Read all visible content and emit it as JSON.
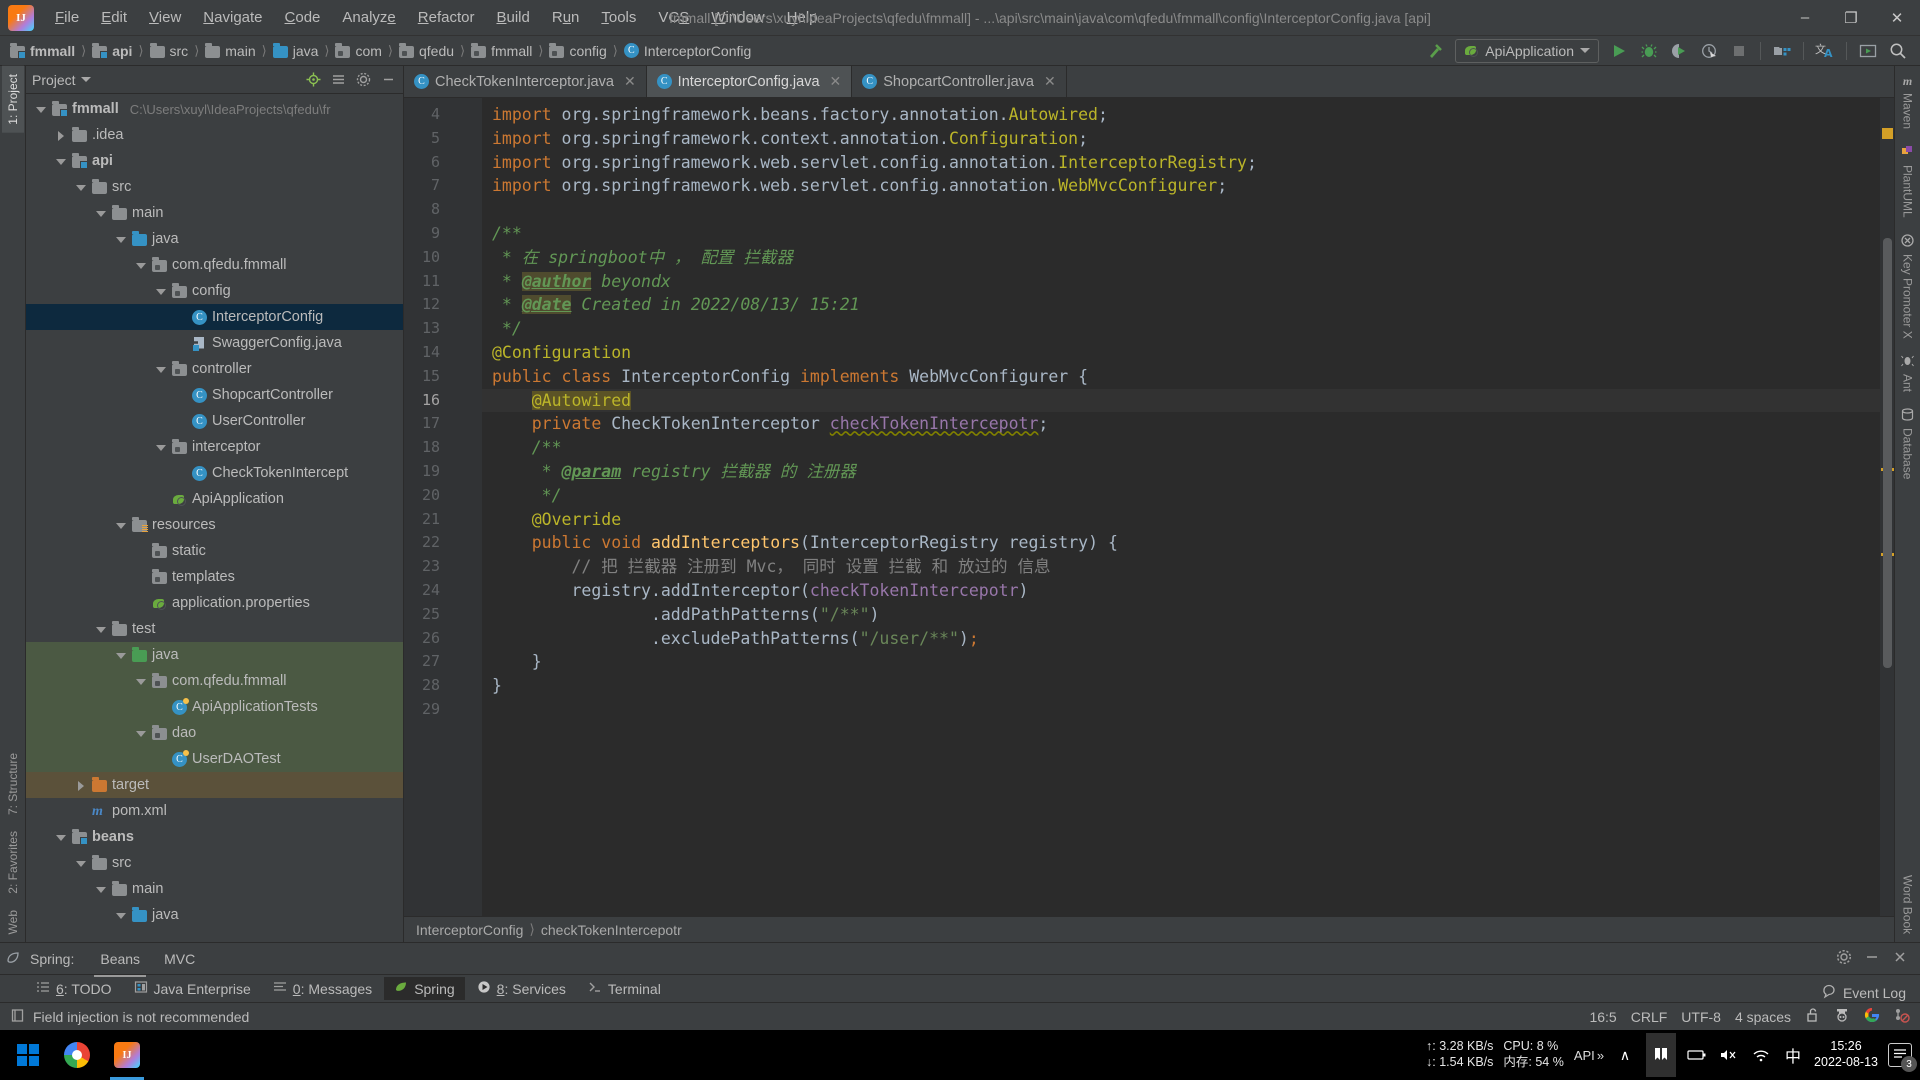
{
  "window": {
    "title": "fmmall [C:\\Users\\xuyl\\IdeaProjects\\qfedu\\fmmall] - ...\\api\\src\\main\\java\\com\\qfedu\\fmmall\\config\\InterceptorConfig.java [api]",
    "minimize": "–",
    "maximize": "❐",
    "close": "✕"
  },
  "menu": [
    {
      "label": "File"
    },
    {
      "label": "Edit"
    },
    {
      "label": "View"
    },
    {
      "label": "Navigate"
    },
    {
      "label": "Code"
    },
    {
      "label": "Analyze"
    },
    {
      "label": "Refactor"
    },
    {
      "label": "Build"
    },
    {
      "label": "Run"
    },
    {
      "label": "Tools"
    },
    {
      "label": "VCS"
    },
    {
      "label": "Window"
    },
    {
      "label": "Help"
    }
  ],
  "breadcrumbs": [
    {
      "label": "fmmall",
      "icon": "module-icon",
      "bold": true
    },
    {
      "label": "api",
      "icon": "module-icon",
      "bold": true
    },
    {
      "label": "src",
      "icon": "folder-icon"
    },
    {
      "label": "main",
      "icon": "folder-icon"
    },
    {
      "label": "java",
      "icon": "source-folder-icon"
    },
    {
      "label": "com",
      "icon": "package-icon"
    },
    {
      "label": "qfedu",
      "icon": "package-icon"
    },
    {
      "label": "fmmall",
      "icon": "package-icon"
    },
    {
      "label": "config",
      "icon": "package-icon"
    },
    {
      "label": "InterceptorConfig",
      "icon": "class-icon"
    }
  ],
  "toolbar": {
    "run_config": "ApiApplication",
    "buttons": [
      {
        "name": "build-hammer-icon",
        "glyph": "⚒"
      },
      {
        "name": "run-icon",
        "glyph": "▶"
      },
      {
        "name": "debug-icon",
        "glyph": "🐞"
      },
      {
        "name": "run-coverage-icon",
        "glyph": "◑"
      },
      {
        "name": "profiler-icon",
        "glyph": "⏱"
      },
      {
        "name": "stop-icon",
        "glyph": "■"
      },
      {
        "name": "project-structure-icon",
        "glyph": "▤"
      },
      {
        "name": "translate-icon",
        "glyph": "文A"
      },
      {
        "name": "presentation-icon",
        "glyph": "▭"
      },
      {
        "name": "search-everywhere-icon",
        "glyph": "🔍"
      }
    ]
  },
  "project_panel": {
    "title": "Project",
    "tree": [
      {
        "label": "fmmall",
        "path": "C:\\Users\\xuyl\\IdeaProjects\\qfedu\\fr",
        "indent": 0,
        "arrow": "open",
        "icon": "module-icon",
        "bold": true
      },
      {
        "label": ".idea",
        "indent": 1,
        "arrow": "closed",
        "icon": "folder-icon"
      },
      {
        "label": "api",
        "indent": 1,
        "arrow": "open",
        "icon": "module-icon",
        "bold": true
      },
      {
        "label": "src",
        "indent": 2,
        "arrow": "open",
        "icon": "folder-icon"
      },
      {
        "label": "main",
        "indent": 3,
        "arrow": "open",
        "icon": "folder-icon"
      },
      {
        "label": "java",
        "indent": 4,
        "arrow": "open",
        "icon": "source-folder-icon"
      },
      {
        "label": "com.qfedu.fmmall",
        "indent": 5,
        "arrow": "open",
        "icon": "package-icon"
      },
      {
        "label": "config",
        "indent": 6,
        "arrow": "open",
        "icon": "package-icon"
      },
      {
        "label": "InterceptorConfig",
        "indent": 7,
        "arrow": "none",
        "icon": "class-icon",
        "selected": true
      },
      {
        "label": "SwaggerConfig.java",
        "indent": 7,
        "arrow": "none",
        "icon": "swagger-icon"
      },
      {
        "label": "controller",
        "indent": 6,
        "arrow": "open",
        "icon": "package-icon"
      },
      {
        "label": "ShopcartController",
        "indent": 7,
        "arrow": "none",
        "icon": "class-icon"
      },
      {
        "label": "UserController",
        "indent": 7,
        "arrow": "none",
        "icon": "class-icon"
      },
      {
        "label": "interceptor",
        "indent": 6,
        "arrow": "open",
        "icon": "package-icon"
      },
      {
        "label": "CheckTokenIntercept",
        "indent": 7,
        "arrow": "none",
        "icon": "class-icon"
      },
      {
        "label": "ApiApplication",
        "indent": 6,
        "arrow": "none",
        "icon": "spring-icon"
      },
      {
        "label": "resources",
        "indent": 4,
        "arrow": "open",
        "icon": "resource-folder-icon"
      },
      {
        "label": "static",
        "indent": 5,
        "arrow": "none",
        "icon": "package-icon"
      },
      {
        "label": "templates",
        "indent": 5,
        "arrow": "none",
        "icon": "package-icon"
      },
      {
        "label": "application.properties",
        "indent": 5,
        "arrow": "none",
        "icon": "spring-icon"
      },
      {
        "label": "test",
        "indent": 3,
        "arrow": "open",
        "icon": "folder-icon"
      },
      {
        "label": "java",
        "indent": 4,
        "arrow": "open",
        "icon": "test-source-folder-icon",
        "bg": "green"
      },
      {
        "label": "com.qfedu.fmmall",
        "indent": 5,
        "arrow": "open",
        "icon": "package-icon",
        "bg": "green"
      },
      {
        "label": "ApiApplicationTests",
        "indent": 6,
        "arrow": "none",
        "icon": "test-class-icon",
        "bg": "green"
      },
      {
        "label": "dao",
        "indent": 5,
        "arrow": "open",
        "icon": "package-icon",
        "bg": "green"
      },
      {
        "label": "UserDAOTest",
        "indent": 6,
        "arrow": "none",
        "icon": "test-class-icon",
        "bg": "green"
      },
      {
        "label": "target",
        "indent": 2,
        "arrow": "closed",
        "icon": "excluded-folder-icon",
        "bg": "brown"
      },
      {
        "label": "pom.xml",
        "indent": 2,
        "arrow": "none",
        "icon": "maven-icon"
      },
      {
        "label": "beans",
        "indent": 1,
        "arrow": "open",
        "icon": "module-icon",
        "bold": true
      },
      {
        "label": "src",
        "indent": 2,
        "arrow": "open",
        "icon": "folder-icon"
      },
      {
        "label": "main",
        "indent": 3,
        "arrow": "open",
        "icon": "folder-icon"
      },
      {
        "label": "java",
        "indent": 4,
        "arrow": "open",
        "icon": "source-folder-icon"
      }
    ]
  },
  "left_strip": [
    {
      "label": "1: Project",
      "selected": true
    },
    {
      "label": "7: Structure",
      "selected": false
    },
    {
      "label": "2: Favorites",
      "selected": false
    },
    {
      "label": "Web",
      "selected": false
    }
  ],
  "right_strip": [
    {
      "label": "Maven",
      "icon": "maven-icon"
    },
    {
      "label": "PlantUML",
      "icon": "plantuml-icon"
    },
    {
      "label": "Key Promoter X",
      "icon": "key-promoter-icon"
    },
    {
      "label": "Ant",
      "icon": "ant-icon"
    },
    {
      "label": "Database",
      "icon": "database-icon"
    },
    {
      "label": "Word Book",
      "icon": "wordbook-icon"
    }
  ],
  "editor_tabs": [
    {
      "label": "CheckTokenInterceptor.java",
      "active": false
    },
    {
      "label": "InterceptorConfig.java",
      "active": true
    },
    {
      "label": "ShopcartController.java",
      "active": false
    }
  ],
  "editor": {
    "first_line": 4,
    "last_line": 29,
    "current_line": 16,
    "code_lines": [
      {
        "n": 4,
        "text": "import org.springframework.beans.factory.annotation.Autowired;"
      },
      {
        "n": 5,
        "text": "import org.springframework.context.annotation.Configuration;"
      },
      {
        "n": 6,
        "text": "import org.springframework.web.servlet.config.annotation.InterceptorRegistry;"
      },
      {
        "n": 7,
        "text": "import org.springframework.web.servlet.config.annotation.WebMvcConfigurer;"
      },
      {
        "n": 8,
        "text": ""
      },
      {
        "n": 9,
        "text": "/**"
      },
      {
        "n": 10,
        "text": " * 在 springboot中 ， 配置 拦截器"
      },
      {
        "n": 11,
        "text": " * @author beyondx"
      },
      {
        "n": 12,
        "text": " * @date Created in 2022/08/13/ 15:21"
      },
      {
        "n": 13,
        "text": " */"
      },
      {
        "n": 14,
        "text": "@Configuration"
      },
      {
        "n": 15,
        "text": "public class InterceptorConfig implements WebMvcConfigurer {"
      },
      {
        "n": 16,
        "text": "    @Autowired"
      },
      {
        "n": 17,
        "text": "    private CheckTokenInterceptor checkTokenIntercepotr;"
      },
      {
        "n": 18,
        "text": "    /**"
      },
      {
        "n": 19,
        "text": "     * @param registry 拦截器 的 注册器"
      },
      {
        "n": 20,
        "text": "     */"
      },
      {
        "n": 21,
        "text": "    @Override"
      },
      {
        "n": 22,
        "text": "    public void addInterceptors(InterceptorRegistry registry) {"
      },
      {
        "n": 23,
        "text": "        // 把 拦截器 注册到 Mvc， 同时 设置 拦截 和 放过的 信息"
      },
      {
        "n": 24,
        "text": "        registry.addInterceptor(checkTokenIntercepotr)"
      },
      {
        "n": 25,
        "text": "                .addPathPatterns(\"/**\")"
      },
      {
        "n": 26,
        "text": "                .excludePathPatterns(\"/user/**\");"
      },
      {
        "n": 27,
        "text": "    }"
      },
      {
        "n": 28,
        "text": "}"
      },
      {
        "n": 29,
        "text": ""
      }
    ]
  },
  "editor_breadcrumb": [
    {
      "label": "InterceptorConfig"
    },
    {
      "label": "checkTokenIntercepotr"
    }
  ],
  "spring_panel": {
    "label": "Spring:",
    "tabs": [
      {
        "label": "Beans",
        "selected": true
      },
      {
        "label": "MVC",
        "selected": false
      }
    ],
    "settings_icon": "gear-icon",
    "minimize_icon": "minimize-icon",
    "close_icon": "close-icon"
  },
  "tool_window_bar": [
    {
      "num": "6",
      "label": ": TODO",
      "icon": "todo-icon",
      "selected": false
    },
    {
      "num": "",
      "label": "Java Enterprise",
      "icon": "java-enterprise-icon",
      "selected": false
    },
    {
      "num": "0",
      "label": ": Messages",
      "icon": "messages-icon",
      "selected": false
    },
    {
      "num": "",
      "label": "Spring",
      "icon": "spring-icon",
      "selected": true
    },
    {
      "num": "8",
      "label": ": Services",
      "icon": "services-icon",
      "selected": false
    },
    {
      "num": "",
      "label": "Terminal",
      "icon": "terminal-icon",
      "selected": false
    }
  ],
  "status_bar": {
    "message": "Field injection is not recommended",
    "message_icon": "inspection-icon",
    "event_log": "Event Log",
    "event_log_icon": "event-log-icon",
    "caret": "16:5",
    "line_separator": "CRLF",
    "encoding": "UTF-8",
    "indent": "4 spaces",
    "lock_icon": "unlocked-icon",
    "inspector_icon": "hector-icon",
    "google_icon": "google-icon",
    "git_icon": "vcs-blocked-icon"
  },
  "taskbar": {
    "apps": [
      {
        "name": "chrome-taskbar-icon"
      },
      {
        "name": "idea-taskbar-icon",
        "active": true
      }
    ],
    "net_up": "↑: 3.28 KB/s",
    "net_down": "↓: 1.54 KB/s",
    "cpu": "CPU: 8 %",
    "mem": "内存: 54 %",
    "api_label": "API",
    "overflow": "»",
    "chevron": "∧",
    "time": "15:26",
    "date": "2022-08-13",
    "notification_count": "3",
    "ime": "中"
  },
  "colors": {
    "accent_blue": "#3592c4",
    "selection": "#0d293e",
    "test_green": "#4b5943",
    "excluded_brown": "#5b513a",
    "keyword_orange": "#cc7832",
    "string_green": "#6a8759",
    "annotation_yellow": "#bbb529",
    "field_purple": "#9876aa",
    "javadoc_green": "#629755",
    "method_yellow": "#ffc66d",
    "editor_bg": "#2b2b2b",
    "panel_bg": "#3c3f41"
  }
}
